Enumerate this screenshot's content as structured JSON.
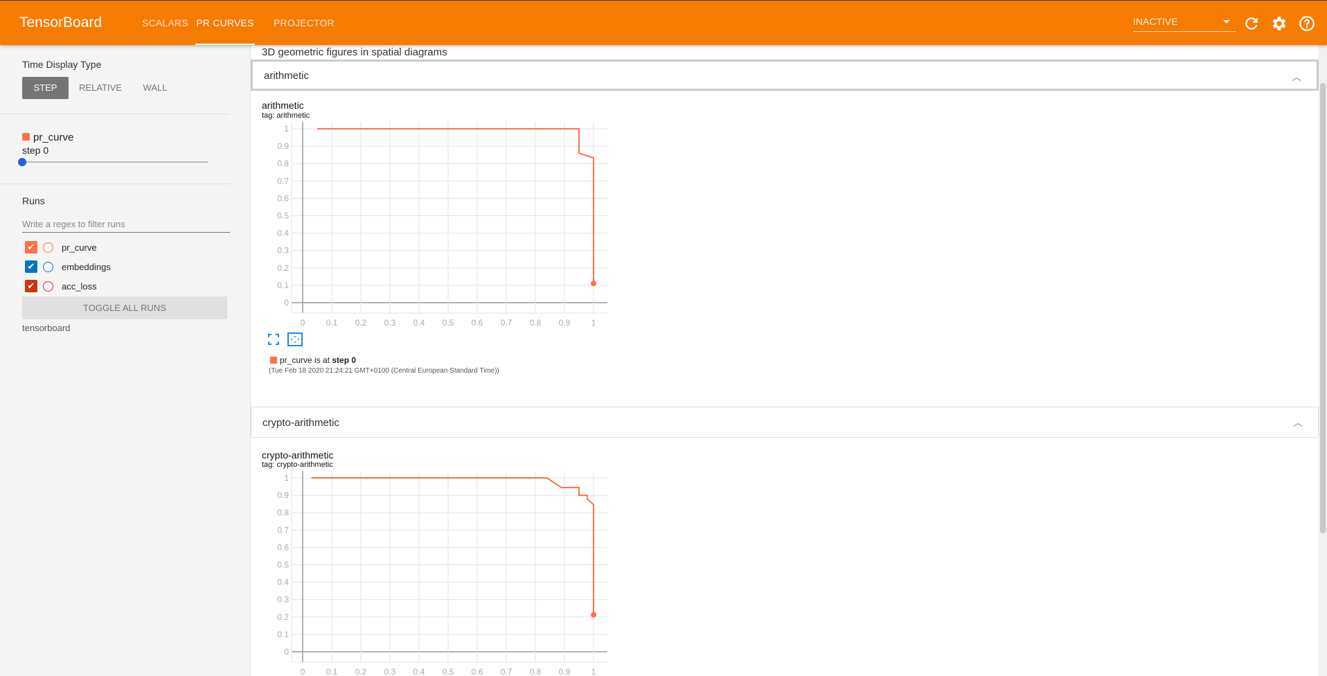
{
  "header": {
    "brand": "TensorBoard",
    "tabs": [
      {
        "label": "SCALARS",
        "active": false
      },
      {
        "label": "PR CURVES",
        "active": true
      },
      {
        "label": "PROJECTOR",
        "active": false
      }
    ],
    "status_select": "INACTIVE",
    "icons": [
      "refresh-icon",
      "settings-icon",
      "help-icon"
    ],
    "color": "#f57c00"
  },
  "sidebar": {
    "time_display_type": {
      "label": "Time Display Type",
      "options": [
        "STEP",
        "RELATIVE",
        "WALL"
      ],
      "selected": "STEP"
    },
    "step_slider": {
      "run": "pr_curve",
      "step_label": "step 0",
      "value": 0
    },
    "runs": {
      "label": "Runs",
      "filter_placeholder": "Write a regex to filter runs",
      "items": [
        {
          "name": "pr_curve",
          "checked": true,
          "color": "#ff7043"
        },
        {
          "name": "embeddings",
          "checked": true,
          "color": "#0077bb"
        },
        {
          "name": "acc_loss",
          "checked": true,
          "color": "#cc3311"
        }
      ],
      "toggle_all": "TOGGLE ALL RUNS",
      "log_dir": "tensorboard"
    }
  },
  "main": {
    "prev_card_title": "3D geometric figures in spatial diagrams",
    "cards": [
      {
        "header": "arithmetic",
        "title": "arithmetic",
        "tag": "tag: arithmetic",
        "legend_run": "pr_curve",
        "legend_text": " is at ",
        "legend_step": "step 0",
        "timestamp": "(Tue Feb 18 2020 21:24:21 GMT+0100 (Central European Standard Time))"
      },
      {
        "header": "crypto-arithmetic",
        "title": "crypto-arithmetic",
        "tag": "tag: crypto-arithmetic"
      }
    ]
  },
  "chart_data": [
    {
      "type": "line",
      "title": "arithmetic",
      "series": [
        {
          "name": "pr_curve",
          "color": "#ff7043",
          "x": [
            0.05,
            0.95,
            0.95,
            1,
            1
          ],
          "y": [
            1,
            1,
            0.86,
            0.833,
            0.11
          ]
        }
      ],
      "xlim": [
        0,
        1
      ],
      "ylim": [
        0,
        1
      ],
      "xticks": [
        "0",
        "0.1",
        "0.2",
        "0.3",
        "0.4",
        "0.5",
        "0.6",
        "0.7",
        "0.8",
        "0.9",
        "1"
      ],
      "yticks": [
        "0",
        "0.1",
        "0.2",
        "0.3",
        "0.4",
        "0.5",
        "0.6",
        "0.7",
        "0.8",
        "0.9",
        "1"
      ],
      "grid": true
    },
    {
      "type": "line",
      "title": "crypto-arithmetic",
      "series": [
        {
          "name": "pr_curve",
          "color": "#ff7043",
          "x": [
            0.03,
            0.84,
            0.89,
            0.95,
            0.95,
            0.978,
            0.978,
            1,
            1
          ],
          "y": [
            1,
            1,
            0.944,
            0.945,
            0.9,
            0.9,
            0.88,
            0.846,
            0.213
          ]
        }
      ],
      "xlim": [
        0,
        1
      ],
      "ylim": [
        0,
        1
      ],
      "xticks": [
        "0",
        "0.1",
        "0.2",
        "0.3",
        "0.4",
        "0.5",
        "0.6",
        "0.7",
        "0.8",
        "0.9",
        "1"
      ],
      "yticks": [
        "0",
        "0.1",
        "0.2",
        "0.3",
        "0.4",
        "0.5",
        "0.6",
        "0.7",
        "0.8",
        "0.9",
        "1"
      ],
      "grid": true
    }
  ]
}
